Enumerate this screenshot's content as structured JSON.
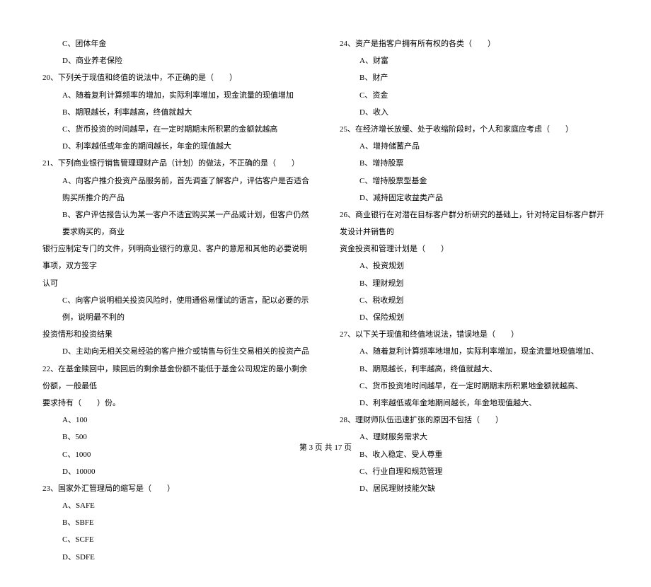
{
  "left_column": [
    {
      "cls": "option",
      "text": "C、团体年金"
    },
    {
      "cls": "option",
      "text": "D、商业养老保险"
    },
    {
      "cls": "question",
      "text": "20、下列关于现值和终值的说法中，不正确的是（　　）"
    },
    {
      "cls": "option",
      "text": "A、随着复利计算频率的增加，实际利率增加，现金流量的现值增加"
    },
    {
      "cls": "option",
      "text": "B、期限越长，利率越高，终值就越大"
    },
    {
      "cls": "option",
      "text": "C、货币投资的时间越早，在一定时期期末所积累的金额就越高"
    },
    {
      "cls": "option",
      "text": "D、利率越低或年金的期间越长，年金的现值越大"
    },
    {
      "cls": "question",
      "text": "21、下列商业银行销售管理理财产品（计划）的做法，不正确的是（　　）"
    },
    {
      "cls": "option",
      "text": "A、向客户推介投资产品服务前，首先调查了解客户，评估客户是否适合购买所推介的产品"
    },
    {
      "cls": "option",
      "text": "B、客户评估报告认为某一客户不适宜购买某一产品或计划，但客户仍然要求购买的，商业"
    },
    {
      "cls": "question-continued",
      "text": "银行应制定专门的文件，列明商业银行的意见、客户的意愿和其他的必要说明事项，双方签字"
    },
    {
      "cls": "question-continued",
      "text": "认可"
    },
    {
      "cls": "option",
      "text": "C、向客户说明相关投资风险时，使用通俗易懂试的语言，配以必要的示例，说明最不利的"
    },
    {
      "cls": "question-continued",
      "text": "投资情形和投资结果"
    },
    {
      "cls": "option",
      "text": "D、主动向无相关交易经验的客户推介或销售与衍生交易相关的投资产品"
    },
    {
      "cls": "question",
      "text": "22、在基金赎回中，赎回后的剩余基金份额不能低于基金公司规定的最小剩余份额，一般最低"
    },
    {
      "cls": "question-continued",
      "text": "要求持有（　　）份。"
    },
    {
      "cls": "option",
      "text": "A、100"
    },
    {
      "cls": "option",
      "text": "B、500"
    },
    {
      "cls": "option",
      "text": "C、1000"
    },
    {
      "cls": "option",
      "text": "D、10000"
    },
    {
      "cls": "question",
      "text": "23、国家外汇管理局的缩写是（　　）"
    },
    {
      "cls": "option",
      "text": "A、SAFE"
    },
    {
      "cls": "option",
      "text": "B、SBFE"
    },
    {
      "cls": "option",
      "text": "C、SCFE"
    },
    {
      "cls": "option",
      "text": "D、SDFE"
    }
  ],
  "right_column": [
    {
      "cls": "question",
      "text": "24、资产是指客户拥有所有权的各类（　　）"
    },
    {
      "cls": "option",
      "text": "A、财富"
    },
    {
      "cls": "option",
      "text": "B、财产"
    },
    {
      "cls": "option",
      "text": "C、资金"
    },
    {
      "cls": "option",
      "text": "D、收入"
    },
    {
      "cls": "question",
      "text": "25、在经济增长放缓、处于收缩阶段时，个人和家庭应考虑（　　）"
    },
    {
      "cls": "option",
      "text": "A、增持储蓄产品"
    },
    {
      "cls": "option",
      "text": "B、增持股票"
    },
    {
      "cls": "option",
      "text": "C、增持股票型基金"
    },
    {
      "cls": "option",
      "text": "D、减持固定收益类产品"
    },
    {
      "cls": "question",
      "text": "26、商业银行在对潜在目标客户群分析研究的基础上，针对特定目标客户群开发设计并销售的"
    },
    {
      "cls": "question-continued",
      "text": "资金投资和管理计划是（　　）"
    },
    {
      "cls": "option",
      "text": "A、投资规划"
    },
    {
      "cls": "option",
      "text": "B、理财规划"
    },
    {
      "cls": "option",
      "text": "C、税收规划"
    },
    {
      "cls": "option",
      "text": "D、保险规划"
    },
    {
      "cls": "question",
      "text": "27、以下关于现值和终值地说法，错误地是（　　）"
    },
    {
      "cls": "option",
      "text": "A、随着复利计算频率地增加，实际利率增加，现金流量地现值增加、"
    },
    {
      "cls": "option",
      "text": "B、期限越长，利率越高，终值就越大、"
    },
    {
      "cls": "option",
      "text": "C、货币投资地时间越早，在一定时期期末所积累地金额就越高、"
    },
    {
      "cls": "option",
      "text": "D、利率越低或年金地期间越长，年金地现值越大、"
    },
    {
      "cls": "question",
      "text": "28、理财师队伍迅速扩张的原因不包括（　　）"
    },
    {
      "cls": "option",
      "text": "A、理财服务需求大"
    },
    {
      "cls": "option",
      "text": "B、收入稳定、受人尊重"
    },
    {
      "cls": "option",
      "text": "C、行业自理和规范管理"
    },
    {
      "cls": "option",
      "text": "D、居民理财技能欠缺"
    }
  ],
  "footer": "第 3 页 共 17 页"
}
